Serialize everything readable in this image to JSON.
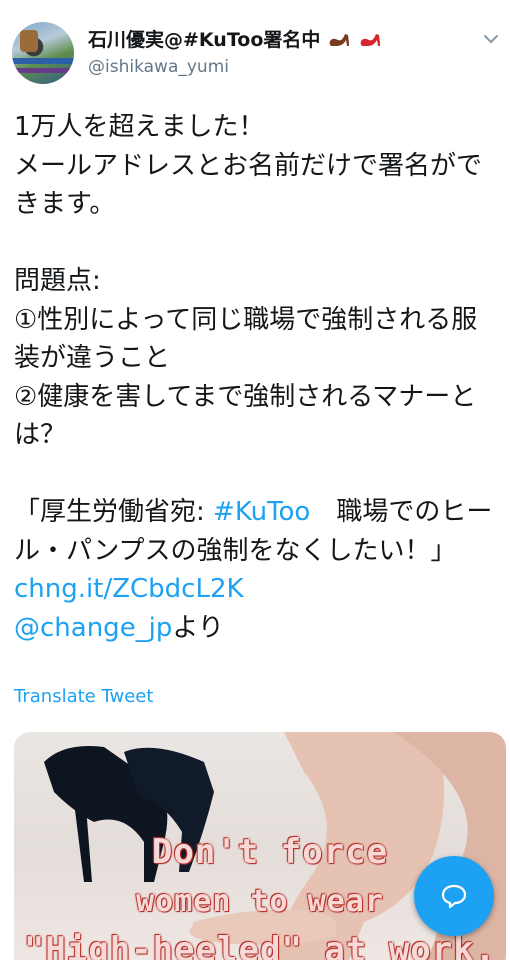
{
  "header": {
    "display_name": "石川優実@#KuToo署名中",
    "handle": "@ishikawa_yumi"
  },
  "tweet": {
    "line1": "1万人を超えました！",
    "line2": "メールアドレスとお名前だけで署名ができます。",
    "line3": "問題点:",
    "line4": "①性別によって同じ職場で強制される服装が違うこと",
    "line5": "②健康を害してまで強制されるマナーとは？",
    "quote_open": "「厚生労働省宛: ",
    "hashtag": "#KuToo",
    "quote_rest": "　職場でのヒール・パンプスの強制をなくしたい！」 ",
    "link": "chng.it/ZCbdcL2K",
    "mention": "@change_jp",
    "mention_suffix": "より"
  },
  "translate_label": "Translate Tweet",
  "media": {
    "caption_line1": "Don't force",
    "caption_line2": "women to wear",
    "caption_line3": "\"High-heeled\" at work."
  },
  "icons": {
    "header_menu": "chevron-down-icon",
    "compose": "speech-bubble-icon",
    "name_emoji": "high-heel-icon"
  },
  "colors": {
    "link": "#1da1f2",
    "secondary_text": "#657786",
    "fab": "#1da1f2"
  }
}
